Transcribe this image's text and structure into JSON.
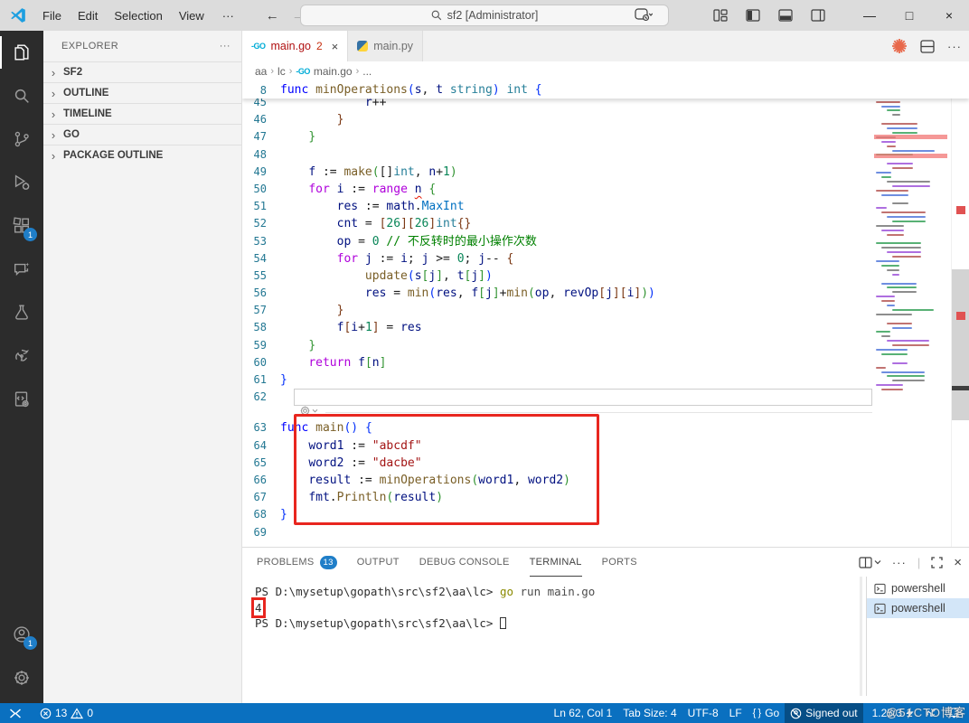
{
  "title_bar": {
    "menus": [
      "File",
      "Edit",
      "Selection",
      "View"
    ],
    "menu_overflow": "···",
    "back_arrow": "←",
    "forward_arrow": "→",
    "search_text": "sf2 [Administrator]",
    "window_controls": {
      "minimize": "—",
      "maximize": "□",
      "close": "×"
    }
  },
  "activity_bar": {
    "items": [
      "explorer",
      "search",
      "source-control",
      "run-and-debug",
      "extensions",
      "chat",
      "testing",
      "go-tools",
      "code-runner"
    ],
    "extensions_badge": "1",
    "account_badge": "1"
  },
  "sidebar": {
    "header": "EXPLORER",
    "header_actions": "···",
    "sections": [
      "SF2",
      "OUTLINE",
      "TIMELINE",
      "GO",
      "PACKAGE OUTLINE"
    ]
  },
  "editor": {
    "tabs": [
      {
        "label": "main.go",
        "badge": "2",
        "close": "×"
      },
      {
        "label": "main.py"
      }
    ],
    "breadcrumb": [
      "aa",
      "lc",
      "main.go",
      "..."
    ],
    "sticky_line": {
      "num": "8",
      "tokens": [
        [
          "func",
          "kw"
        ],
        [
          " ",
          "pl"
        ],
        [
          "minOperations",
          "fn"
        ],
        [
          "(",
          "b1"
        ],
        [
          "s",
          "var"
        ],
        [
          ", ",
          "pl"
        ],
        [
          "t",
          "var"
        ],
        [
          " ",
          "pl"
        ],
        [
          "string",
          "type"
        ],
        [
          ")",
          "b1"
        ],
        [
          " ",
          "pl"
        ],
        [
          "int",
          "type"
        ],
        [
          " ",
          "pl"
        ],
        [
          "{",
          "b1"
        ]
      ]
    },
    "code_lines": [
      {
        "n": "45",
        "t": [
          [
            "            ",
            "pl"
          ],
          [
            "r",
            "var"
          ],
          [
            "++",
            "pl"
          ]
        ]
      },
      {
        "n": "46",
        "t": [
          [
            "        ",
            "pl"
          ],
          [
            "}",
            "b3"
          ]
        ]
      },
      {
        "n": "47",
        "t": [
          [
            "    ",
            "pl"
          ],
          [
            "}",
            "b2"
          ]
        ]
      },
      {
        "n": "48",
        "t": []
      },
      {
        "n": "49",
        "t": [
          [
            "    ",
            "pl"
          ],
          [
            "f",
            "var"
          ],
          [
            " := ",
            "pl"
          ],
          [
            "make",
            "fn"
          ],
          [
            "(",
            "b2"
          ],
          [
            "[]",
            "pl"
          ],
          [
            "int",
            "type"
          ],
          [
            ", ",
            "pl"
          ],
          [
            "n",
            "var"
          ],
          [
            "+",
            "pl"
          ],
          [
            "1",
            "num"
          ],
          [
            ")",
            "b2"
          ]
        ]
      },
      {
        "n": "50",
        "t": [
          [
            "    ",
            "pl"
          ],
          [
            "for",
            "ctrl"
          ],
          [
            " ",
            "pl"
          ],
          [
            "i",
            "var"
          ],
          [
            " := ",
            "pl"
          ],
          [
            "range",
            "ctrl"
          ],
          [
            " ",
            "pl"
          ],
          [
            "n",
            "err"
          ],
          [
            " ",
            "pl"
          ],
          [
            "{",
            "b2"
          ]
        ]
      },
      {
        "n": "51",
        "t": [
          [
            "        ",
            "pl"
          ],
          [
            "res",
            "var"
          ],
          [
            " := ",
            "pl"
          ],
          [
            "math",
            "var"
          ],
          [
            ".",
            "pl"
          ],
          [
            "MaxInt",
            "prop"
          ]
        ]
      },
      {
        "n": "52",
        "t": [
          [
            "        ",
            "pl"
          ],
          [
            "cnt",
            "var"
          ],
          [
            " = ",
            "pl"
          ],
          [
            "[",
            "b3"
          ],
          [
            "26",
            "num"
          ],
          [
            "]",
            "b3"
          ],
          [
            "[",
            "b3"
          ],
          [
            "26",
            "num"
          ],
          [
            "]",
            "b3"
          ],
          [
            "int",
            "type"
          ],
          [
            "{}",
            "b3"
          ]
        ]
      },
      {
        "n": "53",
        "t": [
          [
            "        ",
            "pl"
          ],
          [
            "op",
            "var"
          ],
          [
            " = ",
            "pl"
          ],
          [
            "0",
            "num"
          ],
          [
            " ",
            "pl"
          ],
          [
            "// 不反转时的最小操作次数",
            "com"
          ]
        ]
      },
      {
        "n": "54",
        "t": [
          [
            "        ",
            "pl"
          ],
          [
            "for",
            "ctrl"
          ],
          [
            " ",
            "pl"
          ],
          [
            "j",
            "var"
          ],
          [
            " := ",
            "pl"
          ],
          [
            "i",
            "var"
          ],
          [
            "; ",
            "pl"
          ],
          [
            "j",
            "var"
          ],
          [
            " >= ",
            "pl"
          ],
          [
            "0",
            "num"
          ],
          [
            "; ",
            "pl"
          ],
          [
            "j",
            "var"
          ],
          [
            "--",
            "pl"
          ],
          [
            " ",
            "pl"
          ],
          [
            "{",
            "b3"
          ]
        ]
      },
      {
        "n": "55",
        "t": [
          [
            "            ",
            "pl"
          ],
          [
            "update",
            "fn"
          ],
          [
            "(",
            "b1"
          ],
          [
            "s",
            "var"
          ],
          [
            "[",
            "b2"
          ],
          [
            "j",
            "var"
          ],
          [
            "]",
            "b2"
          ],
          [
            ", ",
            "pl"
          ],
          [
            "t",
            "var"
          ],
          [
            "[",
            "b2"
          ],
          [
            "j",
            "var"
          ],
          [
            "]",
            "b2"
          ],
          [
            ")",
            "b1"
          ]
        ]
      },
      {
        "n": "56",
        "t": [
          [
            "            ",
            "pl"
          ],
          [
            "res",
            "var"
          ],
          [
            " = ",
            "pl"
          ],
          [
            "min",
            "fn"
          ],
          [
            "(",
            "b1"
          ],
          [
            "res",
            "var"
          ],
          [
            ", ",
            "pl"
          ],
          [
            "f",
            "var"
          ],
          [
            "[",
            "b2"
          ],
          [
            "j",
            "var"
          ],
          [
            "]",
            "b2"
          ],
          [
            "+",
            "pl"
          ],
          [
            "min",
            "fn"
          ],
          [
            "(",
            "b2"
          ],
          [
            "op",
            "var"
          ],
          [
            ", ",
            "pl"
          ],
          [
            "revOp",
            "var"
          ],
          [
            "[",
            "b3"
          ],
          [
            "j",
            "var"
          ],
          [
            "]",
            "b3"
          ],
          [
            "[",
            "b3"
          ],
          [
            "i",
            "var"
          ],
          [
            "]",
            "b3"
          ],
          [
            ")",
            "b2"
          ],
          [
            ")",
            "b1"
          ]
        ]
      },
      {
        "n": "57",
        "t": [
          [
            "        ",
            "pl"
          ],
          [
            "}",
            "b3"
          ]
        ]
      },
      {
        "n": "58",
        "t": [
          [
            "        ",
            "pl"
          ],
          [
            "f",
            "var"
          ],
          [
            "[",
            "b3"
          ],
          [
            "i",
            "var"
          ],
          [
            "+",
            "pl"
          ],
          [
            "1",
            "num"
          ],
          [
            "]",
            "b3"
          ],
          [
            " = ",
            "pl"
          ],
          [
            "res",
            "var"
          ]
        ]
      },
      {
        "n": "59",
        "t": [
          [
            "    ",
            "pl"
          ],
          [
            "}",
            "b2"
          ]
        ]
      },
      {
        "n": "60",
        "t": [
          [
            "    ",
            "pl"
          ],
          [
            "return",
            "ctrl"
          ],
          [
            " ",
            "pl"
          ],
          [
            "f",
            "var"
          ],
          [
            "[",
            "b2"
          ],
          [
            "n",
            "var"
          ],
          [
            "]",
            "b2"
          ]
        ]
      },
      {
        "n": "61",
        "t": [
          [
            "}",
            "b1"
          ]
        ]
      },
      {
        "n": "62",
        "t": [],
        "cur": true,
        "zone_after": true
      },
      {
        "n": "63",
        "t": [
          [
            "func",
            "kw"
          ],
          [
            " ",
            "pl"
          ],
          [
            "main",
            "fn"
          ],
          [
            "()",
            "b1"
          ],
          [
            " ",
            "pl"
          ],
          [
            "{",
            "b1"
          ]
        ]
      },
      {
        "n": "64",
        "t": [
          [
            "    ",
            "pl"
          ],
          [
            "word1",
            "var"
          ],
          [
            " := ",
            "pl"
          ],
          [
            "\"abcdf\"",
            "str"
          ]
        ]
      },
      {
        "n": "65",
        "t": [
          [
            "    ",
            "pl"
          ],
          [
            "word2",
            "var"
          ],
          [
            " := ",
            "pl"
          ],
          [
            "\"dacbe\"",
            "str"
          ]
        ]
      },
      {
        "n": "66",
        "t": [
          [
            "    ",
            "pl"
          ],
          [
            "result",
            "var"
          ],
          [
            " := ",
            "pl"
          ],
          [
            "minOperations",
            "fn"
          ],
          [
            "(",
            "b2"
          ],
          [
            "word1",
            "var"
          ],
          [
            ", ",
            "pl"
          ],
          [
            "word2",
            "var"
          ],
          [
            ")",
            "b2"
          ]
        ]
      },
      {
        "n": "67",
        "t": [
          [
            "    ",
            "pl"
          ],
          [
            "fmt",
            "var"
          ],
          [
            ".",
            "pl"
          ],
          [
            "Println",
            "fn"
          ],
          [
            "(",
            "b2"
          ],
          [
            "result",
            "var"
          ],
          [
            ")",
            "b2"
          ]
        ]
      },
      {
        "n": "68",
        "t": [
          [
            "}",
            "b1"
          ]
        ]
      },
      {
        "n": "69",
        "t": []
      }
    ],
    "minimap": {
      "error_offsets": [
        57,
        78
      ]
    }
  },
  "panel": {
    "tabs": [
      {
        "label": "PROBLEMS",
        "badge": "13"
      },
      {
        "label": "OUTPUT"
      },
      {
        "label": "DEBUG CONSOLE"
      },
      {
        "label": "TERMINAL",
        "active": true
      },
      {
        "label": "PORTS"
      }
    ],
    "terminal_rows": [
      {
        "seg": [
          [
            "PS D:\\mysetup\\gopath\\src\\sf2\\aa\\lc> ",
            "d"
          ],
          [
            "go",
            "cmd"
          ],
          [
            " run main.go",
            "d2"
          ]
        ]
      },
      {
        "seg": [
          [
            "4",
            "d"
          ]
        ],
        "boxed": true
      },
      {
        "seg": [
          [
            "PS D:\\mysetup\\gopath\\src\\sf2\\aa\\lc> ",
            "d"
          ]
        ],
        "cursor": true
      }
    ],
    "terminal_list": {
      "items": [
        "powershell",
        "powershell"
      ],
      "selected": 1
    }
  },
  "status_bar": {
    "errors": "13",
    "warnings": "0",
    "cursor_position": "Ln 62, Col 1",
    "tab_size": "Tab Size: 4",
    "encoding": "UTF-8",
    "eol": "LF",
    "language": "Go",
    "account": "Signed out",
    "go_version": "1.25.3"
  },
  "watermark": "@51CTO博客",
  "colors": {
    "statusbar_blue": "#0a70c0",
    "annotation_red": "#e8261f",
    "badge_blue": "#1f7ec8",
    "go_cyan": "#00acd7",
    "starburst_orange": "#e8684a"
  }
}
